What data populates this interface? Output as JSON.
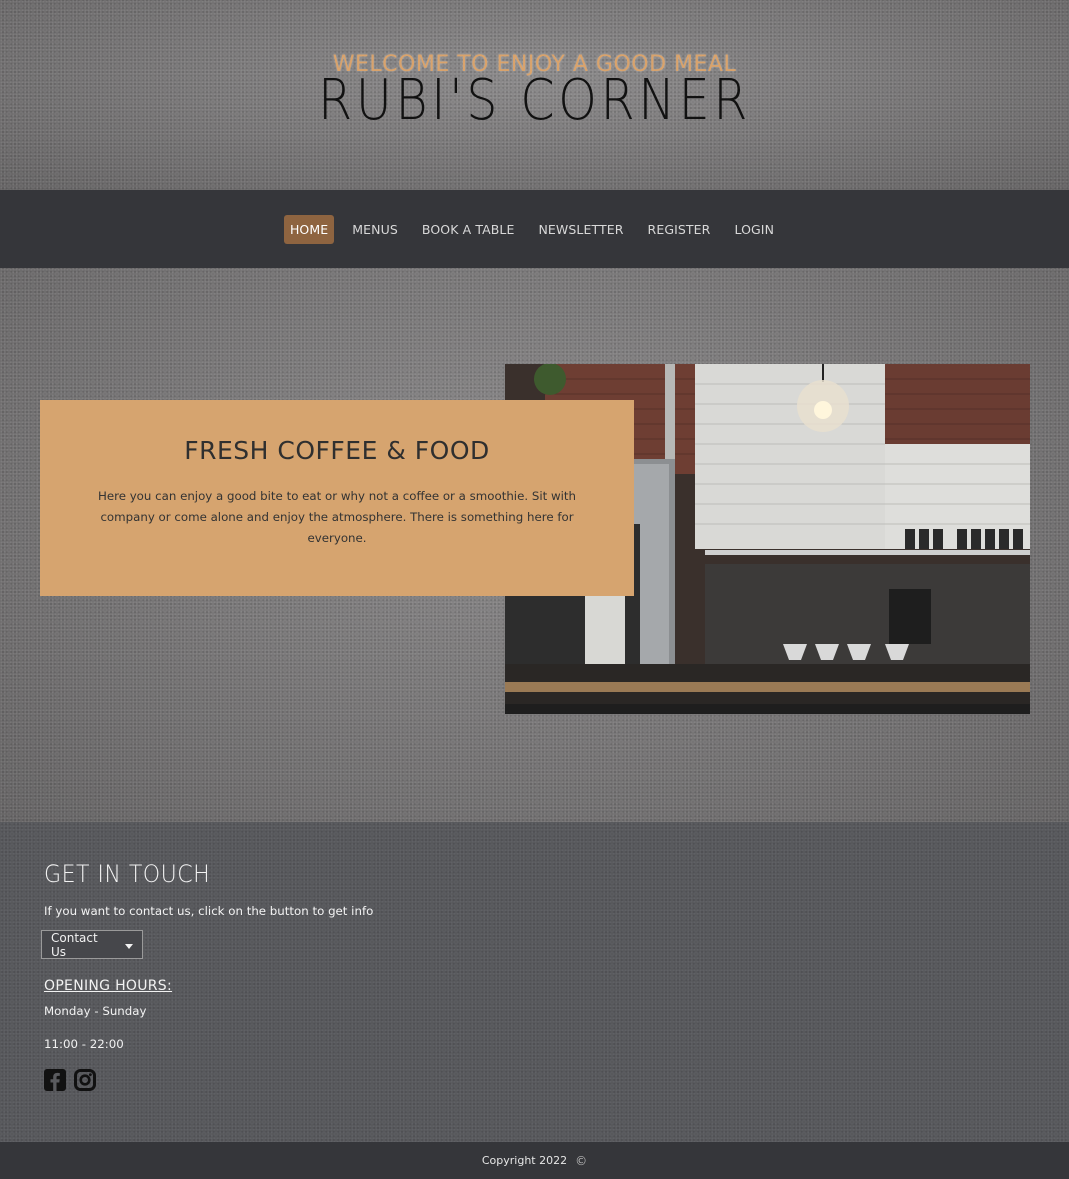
{
  "header": {
    "welcome": "WELCOME TO ENJOY A GOOD MEAL",
    "brand": "RUBI'S CORNER"
  },
  "nav": {
    "items": [
      {
        "label": "HOME",
        "active": true
      },
      {
        "label": "MENUS"
      },
      {
        "label": "BOOK A TABLE"
      },
      {
        "label": "NEWSLETTER"
      },
      {
        "label": "REGISTER"
      },
      {
        "label": "LOGIN"
      }
    ]
  },
  "hero": {
    "title": "FRESH COFFEE & FOOD",
    "text": "Here you can enjoy a good bite to eat or why not a coffee or a smoothie. Sit with company or come alone and enjoy the atmosphere. There is something here for everyone."
  },
  "footer": {
    "title": "GET IN TOUCH",
    "intro": "If you want to contact us, click on the button to get info",
    "contact_button": "Contact Us",
    "hours_title": "OPENING HOURS:",
    "hours_days": "Monday - Sunday",
    "hours_time": "11:00 - 22:00",
    "socials": [
      "facebook-icon",
      "instagram-icon"
    ]
  },
  "copyright": {
    "text": "Copyright 2022",
    "symbol": "©"
  },
  "colors": {
    "accent": "#d6a46f",
    "nav_active": "#8e6440",
    "nav_bg": "#35363a",
    "welcome": "#d9a36c"
  }
}
